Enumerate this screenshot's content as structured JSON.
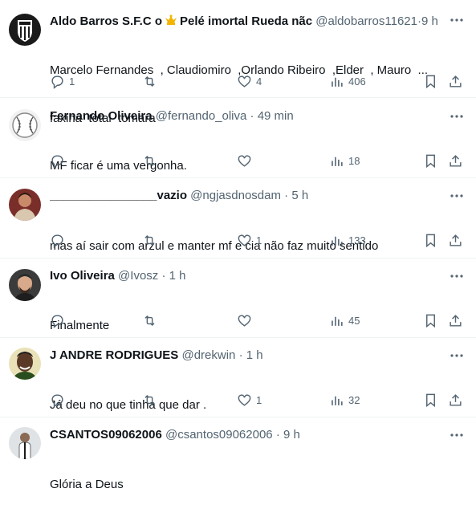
{
  "tweets": [
    {
      "name": "Aldo Barros S.F.C o",
      "name_suffix": "Pelé imortal Rueda nãc",
      "handle": "@aldobarros11621",
      "time": "9 h",
      "text_lines": [
        "Marcelo Fernandes  , Claudiomiro  ,Orlando Ribeiro  ,Elder  , Mauro  ...",
        "faxina  total  tomara"
      ],
      "replies": "1",
      "retweets": "",
      "likes": "4",
      "views": "406",
      "avatar_icon": "santos-badge-avatar"
    },
    {
      "name": "Fernando Oliveira",
      "handle": "@fernando_oliva",
      "time": "49 min",
      "text_lines": [
        "MF ficar é uma vergonha."
      ],
      "replies": "",
      "retweets": "",
      "likes": "",
      "views": "18",
      "avatar_icon": "baseball-avatar"
    },
    {
      "name": "________________vazio",
      "handle": "@ngjasdnosdam",
      "time": "5 h",
      "text_lines": [
        "mas aí sair com arzul e manter mf e cia não faz muito sentido"
      ],
      "replies": "",
      "retweets": "",
      "likes": "1",
      "views": "133",
      "avatar_icon": "person-avatar"
    },
    {
      "name": "Ivo Oliveira",
      "handle": "@Ivosz",
      "time": "1 h",
      "text_lines": [
        "Finalmente"
      ],
      "replies": "",
      "retweets": "",
      "likes": "",
      "views": "45",
      "avatar_icon": "person-avatar"
    },
    {
      "name": "J ANDRE RODRIGUES",
      "handle": "@drekwin",
      "time": "1 h",
      "text_lines": [
        "Já deu no que tinha que dar ."
      ],
      "replies": "",
      "retweets": "",
      "likes": "1",
      "views": "32",
      "avatar_icon": "person-avatar"
    },
    {
      "name": "CSANTOS09062006",
      "handle": "@csantos09062006",
      "time": "9 h",
      "text_lines": [
        "Glória a Deus"
      ],
      "replies": "",
      "retweets": "",
      "likes": "",
      "views": "",
      "avatar_icon": "person-avatar"
    }
  ],
  "separator": "·",
  "colors": {
    "text": "#0f1419",
    "secondary": "#536471",
    "divider": "#eff3f4",
    "crown": "#f4b400"
  }
}
